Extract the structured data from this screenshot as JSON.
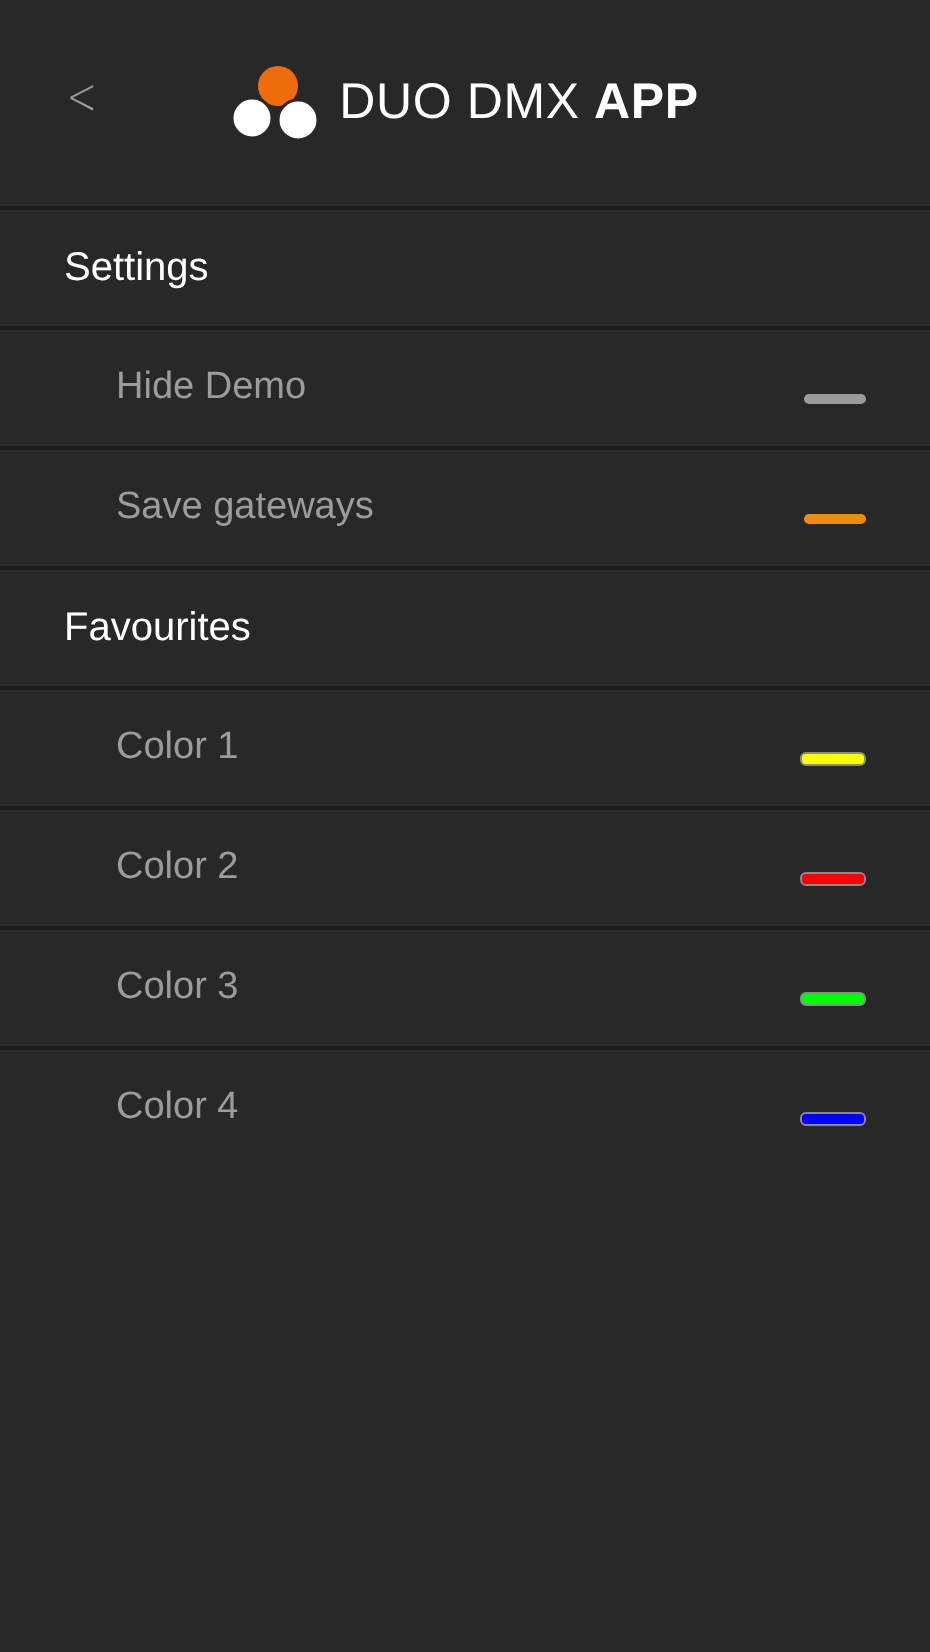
{
  "header": {
    "back": "<",
    "title": "DUO DMX **APP**"
  },
  "sections": [
    {
      "title": "Settings",
      "items": [
        {
          "kind": "toggle",
          "label": "Hide Demo",
          "on": false
        },
        {
          "kind": "toggle",
          "label": "Save gateways",
          "on": true
        }
      ]
    },
    {
      "title": "Favourites",
      "items": [
        {
          "kind": "color",
          "label": "Color 1",
          "color": "#ffff00"
        },
        {
          "kind": "color",
          "label": "Color 2",
          "color": "#ff0000"
        },
        {
          "kind": "color",
          "label": "Color 3",
          "color": "#00ff00"
        },
        {
          "kind": "color",
          "label": "Color 4",
          "color": "#0000ff"
        }
      ]
    }
  ]
}
